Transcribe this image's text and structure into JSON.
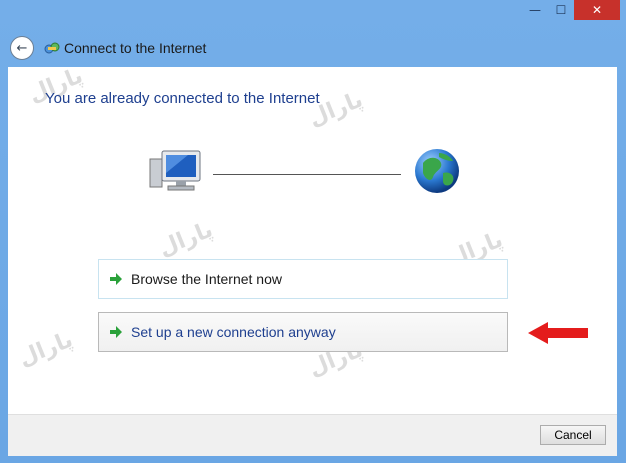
{
  "window": {
    "title": "Connect to the Internet",
    "minimize_glyph": "—",
    "maximize_glyph": "☐",
    "close_glyph": "✕"
  },
  "main": {
    "headline": "You are already connected to the Internet",
    "icons": [
      "computer-icon",
      "globe-icon"
    ]
  },
  "options": [
    {
      "label": "Browse the Internet now",
      "icon": "green-arrow-icon"
    },
    {
      "label": "Set up a new connection anyway",
      "icon": "green-arrow-icon"
    }
  ],
  "footer": {
    "cancel_label": "Cancel"
  },
  "annotation": {
    "color": "#e41c1c"
  },
  "colors": {
    "accent": "#1e3f8f",
    "frame": "#6aa6e4",
    "close": "#c7312b"
  }
}
